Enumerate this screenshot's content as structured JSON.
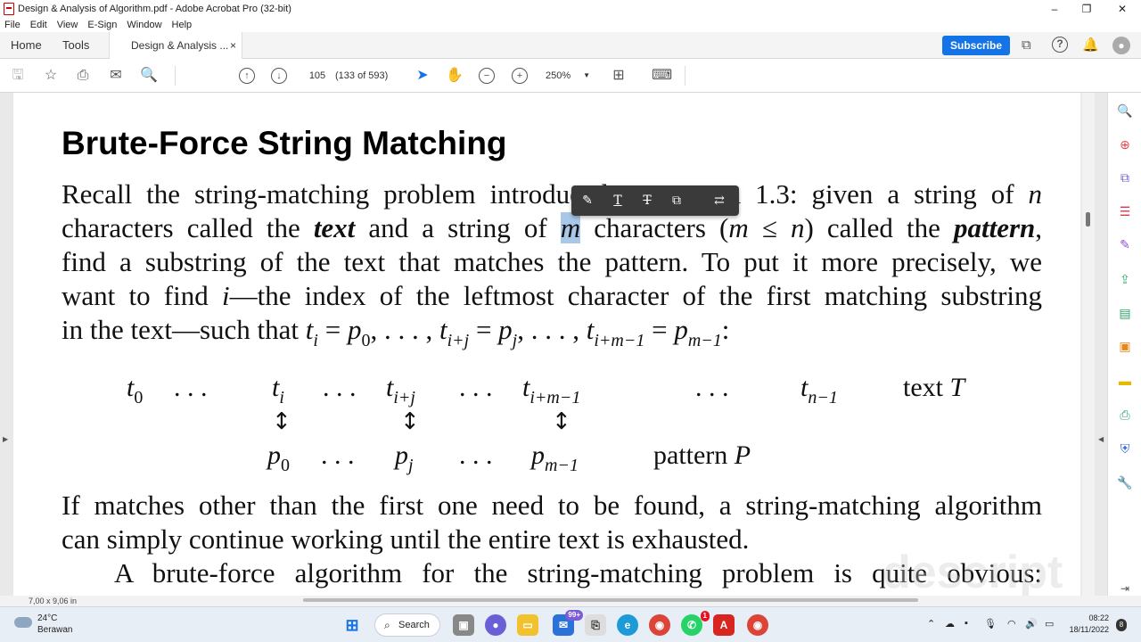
{
  "window": {
    "title": "Design & Analysis of Algorithm.pdf - Adobe Acrobat Pro (32-bit)",
    "minimize": "–",
    "maximize": "❐",
    "close": "✕"
  },
  "menu": [
    "File",
    "Edit",
    "View",
    "E-Sign",
    "Window",
    "Help"
  ],
  "tabs": {
    "home": "Home",
    "tools": "Tools",
    "doc": "Design & Analysis ...",
    "close": "×"
  },
  "header": {
    "subscribe": "Subscribe"
  },
  "toolbar": {
    "page_number": "105",
    "page_count": "(133 of 593)",
    "zoom": "250%"
  },
  "document": {
    "title": "Brute-Force String Matching",
    "para1": {
      "l1": "Recall the string-matching problem introduced in Section 1.3: given a string of",
      "l1_var": "n",
      "l2_a": "characters called the",
      "l2_text": "text",
      "l2_b": "and a string of",
      "l2_m": "m",
      "l2_c": "characters (",
      "l2_m2": "m",
      "l2_leq": " ≤ ",
      "l2_n": "n",
      "l2_d": ") called the",
      "l2_pattern": "pattern",
      "l2_e": ",",
      "l3": "find a substring of the text that matches the pattern. To put it more precisely, we",
      "l4_a": "want to find",
      "l4_i": "i",
      "l4_b": "—the index of the leftmost character of the first matching substring",
      "l5": "in the text—such that"
    },
    "diagram": {
      "t0": "t",
      "t0_sub": "0",
      "dots1": ". . .",
      "ti": "t",
      "ti_sub": "i",
      "dots2": ". . .",
      "tij": "t",
      "tij_sub": "i+j",
      "dots3": ". . .",
      "tim": "t",
      "tim_sub": "i+m−1",
      "dots4": ". . .",
      "tn": "t",
      "tn_sub": "n−1",
      "text_label": "text",
      "text_var": "T",
      "arrow": "↕",
      "p0": "p",
      "p0_sub": "0",
      "dots5": ". . .",
      "pj": "p",
      "pj_sub": "j",
      "dots6": ". . .",
      "pm": "p",
      "pm_sub": "m−1",
      "pattern_label": "pattern",
      "pattern_var": "P"
    },
    "para2": {
      "l1": "If matches other than the first one need to be found, a string-matching algorithm",
      "l2": "can simply continue working until the entire text is exhausted.",
      "l3": "A brute-force algorithm for the string-matching problem is quite obvious:"
    },
    "watermark": "descript"
  },
  "status": {
    "page_size": "7,00 x 9,06 in"
  },
  "taskbar": {
    "temp": "24°C",
    "weather": "Berawan",
    "search": "Search",
    "badge_mail": "99+",
    "badge_whatsapp": "1",
    "time": "08:22",
    "date": "18/11/2022",
    "notifications": "8"
  }
}
